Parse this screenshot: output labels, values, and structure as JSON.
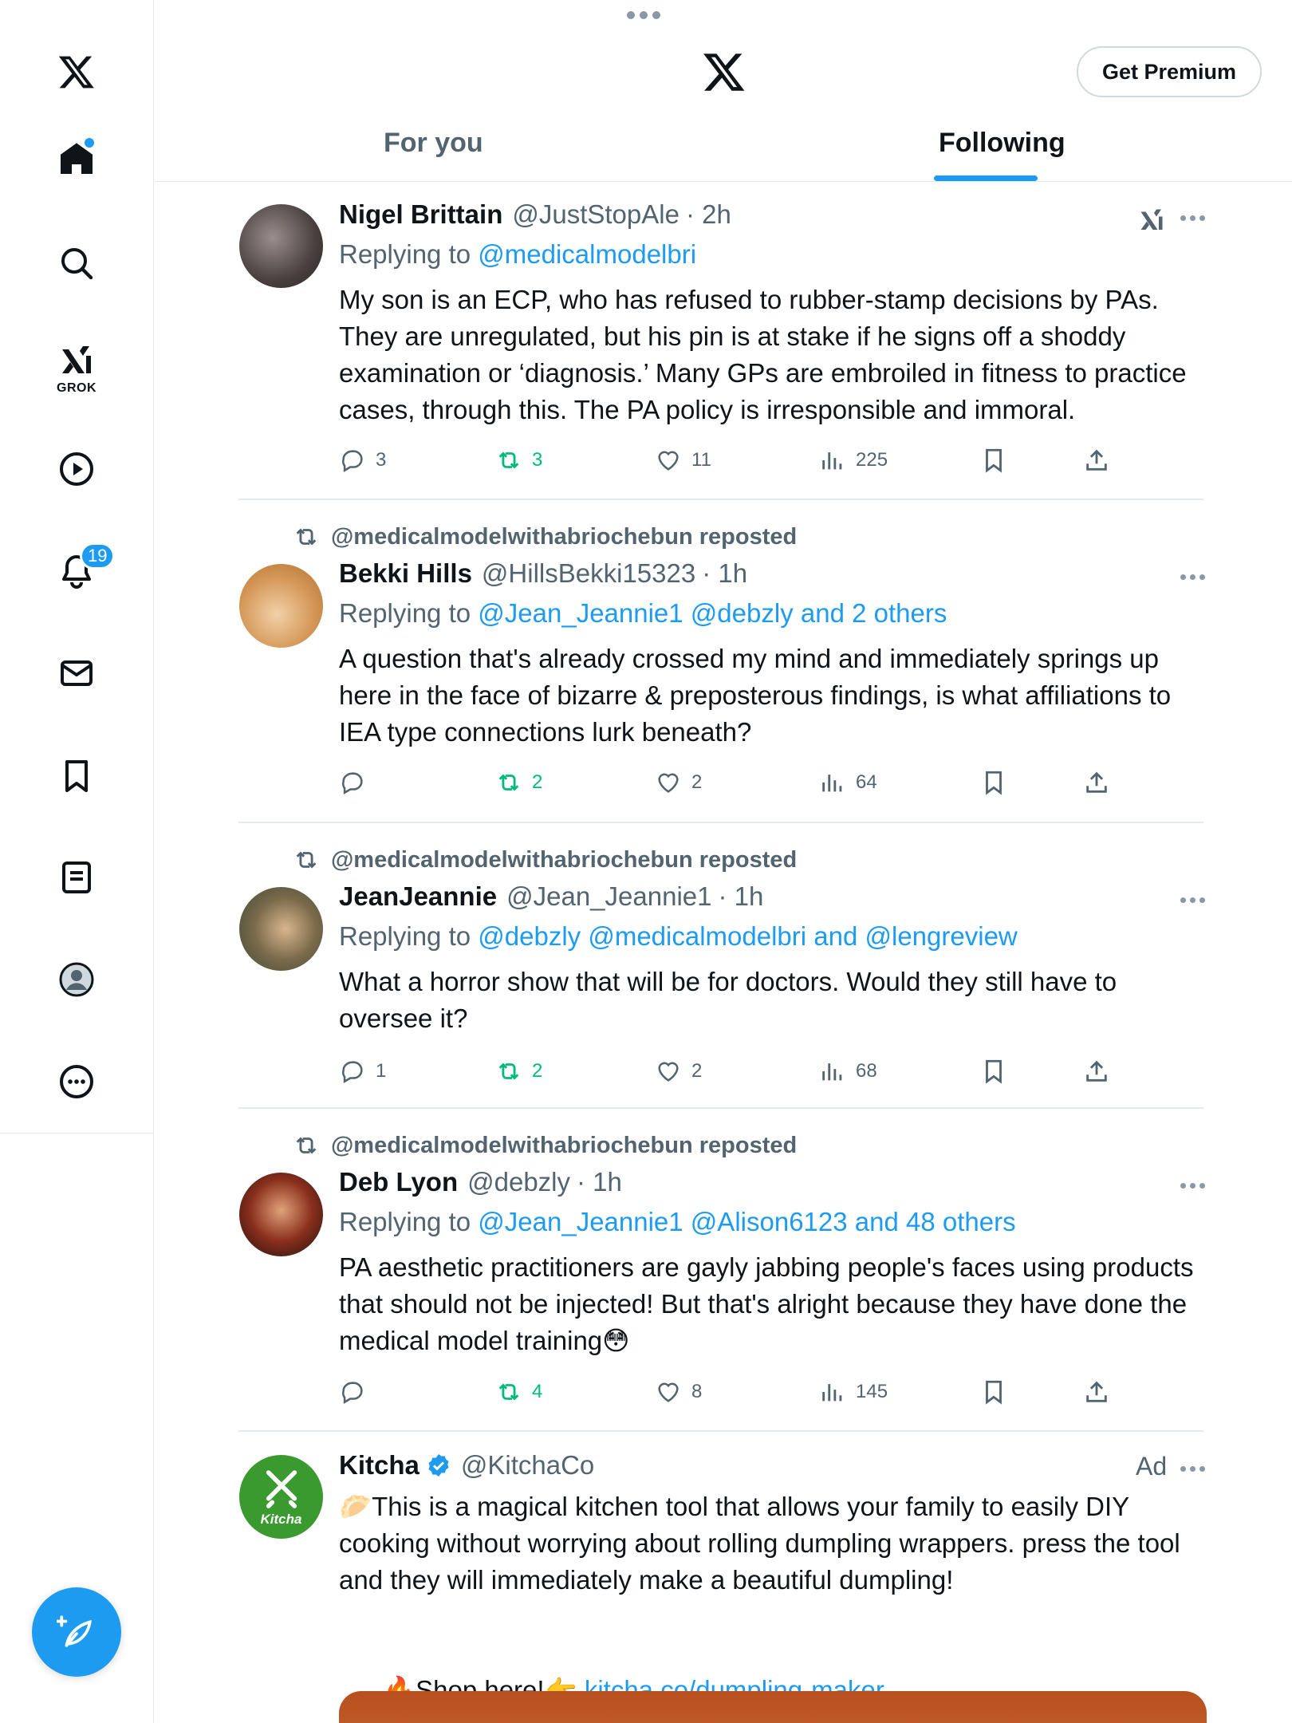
{
  "colors": {
    "accent": "#1d9bf0",
    "repost_green": "#00ba7c",
    "text_secondary": "#536471"
  },
  "sidebar": {
    "items": [
      {
        "icon": "x-logo-icon"
      },
      {
        "icon": "home-icon"
      },
      {
        "icon": "search-icon"
      },
      {
        "icon": "grok-icon",
        "label": "GROK"
      },
      {
        "icon": "video-icon"
      },
      {
        "icon": "notifications-icon",
        "badge": "19"
      },
      {
        "icon": "messages-icon"
      },
      {
        "icon": "bookmarks-icon"
      },
      {
        "icon": "lists-icon"
      },
      {
        "icon": "profile-icon"
      },
      {
        "icon": "more-icon"
      }
    ],
    "compose_icon": "compose-post-icon"
  },
  "header": {
    "premium_label": "Get Premium",
    "tabs": [
      {
        "label": "For you",
        "selected": false
      },
      {
        "label": "Following",
        "selected": true
      }
    ]
  },
  "posts": [
    {
      "name": "Nigel Brittain",
      "handle": "@JustStopAle",
      "time": "· 2h",
      "reply_prefix": "Replying to",
      "reply_targets": "@medicalmodelbri",
      "text": "My son is an ECP, who has refused to rubber-stamp decisions by PAs. They are unregulated, but his pin is at stake if he signs off a shoddy examination or ‘diagnosis.’ Many GPs are embroiled in fitness to practice cases, through this. The PA policy is irresponsible and immoral.",
      "replies": "3",
      "reposts": "3",
      "likes": "11",
      "views": "225"
    },
    {
      "repost_by": "@medicalmodelwithabriochebun reposted",
      "name": "Bekki Hills",
      "handle": "@HillsBekki15323",
      "time": "· 1h",
      "reply_prefix": "Replying to",
      "reply_targets": "@Jean_Jeannie1 @debzly and 2 others",
      "text": "A question that's already crossed my mind and immediately springs up here in the face of bizarre & preposterous findings, is what affiliations to IEA type connections lurk beneath?",
      "replies": "",
      "reposts": "2",
      "likes": "2",
      "views": "64"
    },
    {
      "repost_by": "@medicalmodelwithabriochebun reposted",
      "name": "JeanJeannie",
      "handle": "@Jean_Jeannie1",
      "time": "· 1h",
      "reply_prefix": "Replying to",
      "reply_targets": "@debzly @medicalmodelbri and @lengreview",
      "text": "What a horror show that will be for doctors. Would they still have to oversee it?",
      "replies": "1",
      "reposts": "2",
      "likes": "2",
      "views": "68"
    },
    {
      "repost_by": "@medicalmodelwithabriochebun reposted",
      "name": "Deb Lyon",
      "handle": "@debzly",
      "time": "· 1h",
      "reply_prefix": "Replying to",
      "reply_targets": "@Jean_Jeannie1 @Alison6123 and 48 others",
      "text": "PA aesthetic practitioners are gayly jabbing people's faces using products that should not be injected! But that's alright because they have done the medical model training😳",
      "replies": "",
      "reposts": "4",
      "likes": "8",
      "views": "145"
    }
  ],
  "ad": {
    "name": "Kitcha",
    "handle": "@KitchaCo",
    "label": "Ad",
    "avatar_text": "Kitcha",
    "text": "🥟This is a magical kitchen tool that allows your family to easily DIY cooking without worrying about rolling dumpling wrappers. press the tool and they will immediately make a beautiful dumpling!",
    "shop_text": "🔥Shop here!👉 ",
    "link": "kitcha.co/dumpling-maker"
  }
}
